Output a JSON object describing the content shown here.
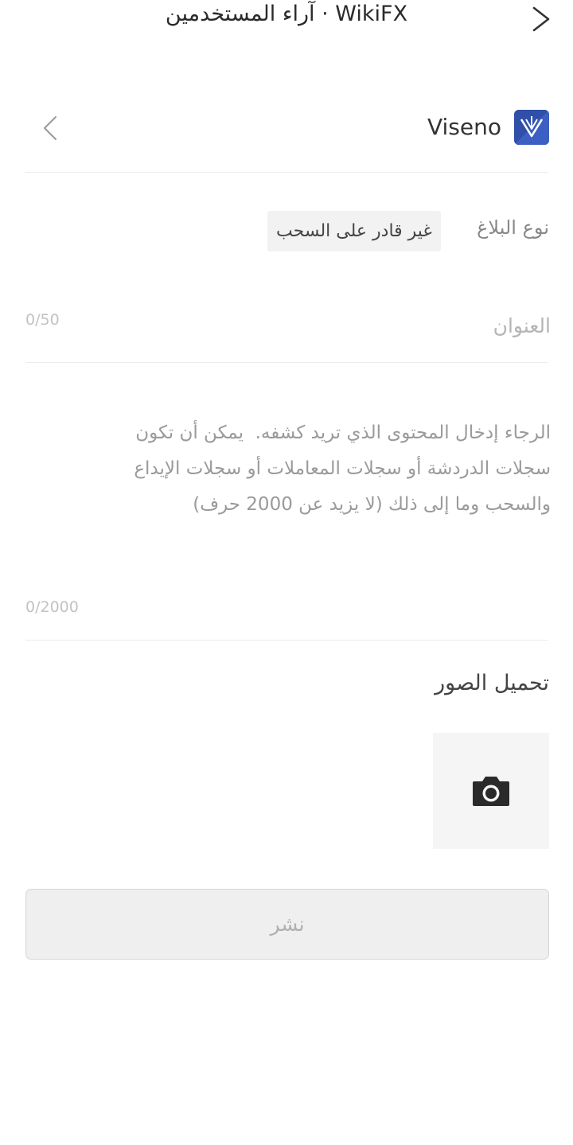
{
  "header": {
    "title": "آراء المستخدمين · WikiFX",
    "back_icon": "chevron-right-icon"
  },
  "broker": {
    "name": "Viseno",
    "logo_icon": "viseno-logo",
    "select_icon": "chevron-left-icon"
  },
  "report_type": {
    "label": "نوع البلاغ",
    "selected": "غير قادر على السحب"
  },
  "title_field": {
    "placeholder": "العنوان",
    "value": "",
    "counter": "0/50"
  },
  "content_field": {
    "placeholder": "الرجاء إدخال المحتوى الذي تريد كشفه.  يمكن أن تكون سجلات الدردشة أو سجلات المعاملات أو سجلات الإيداع والسحب وما إلى ذلك (لا يزيد عن 2000 حرف)",
    "value": "",
    "counter": "0/2000"
  },
  "upload": {
    "label": "تحميل الصور",
    "icon": "camera-icon"
  },
  "publish_button": {
    "label": "نشر"
  },
  "colors": {
    "logo_bg": "#2f4fa8",
    "chip_bg": "#f2f2f2",
    "button_bg": "#efefef"
  }
}
